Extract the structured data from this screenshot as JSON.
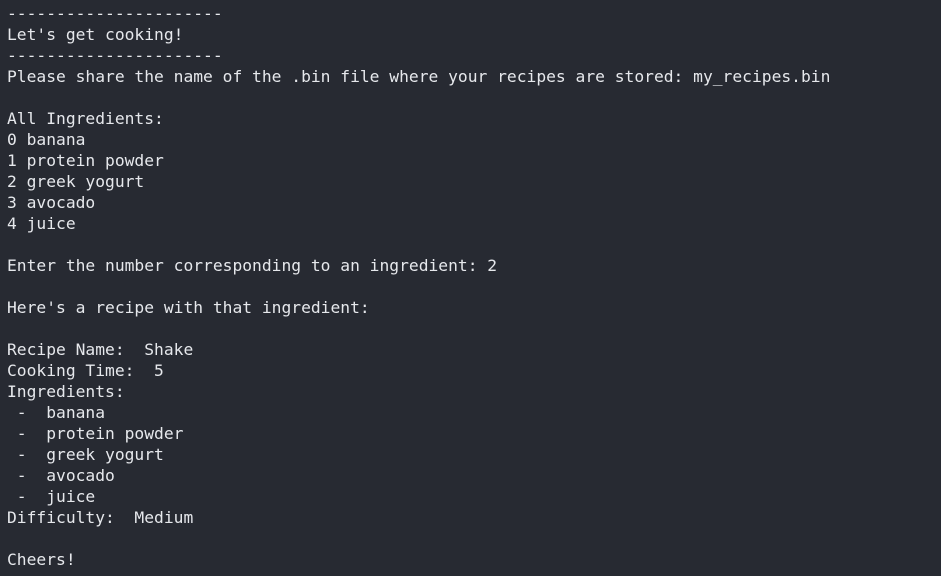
{
  "terminal": {
    "lines": [
      "----------------------",
      "Let's get cooking!",
      "----------------------",
      "Please share the name of the .bin file where your recipes are stored: my_recipes.bin",
      "",
      "All Ingredients:",
      "0 banana",
      "1 protein powder",
      "2 greek yogurt",
      "3 avocado",
      "4 juice",
      "",
      "Enter the number corresponding to an ingredient: 2",
      "",
      "Here's a recipe with that ingredient:",
      "",
      "Recipe Name:  Shake",
      "Cooking Time:  5",
      "Ingredients:",
      " -  banana",
      " -  protein powder",
      " -  greek yogurt",
      " -  avocado",
      " -  juice",
      "Difficulty:  Medium",
      "",
      "Cheers!"
    ]
  },
  "colors": {
    "background": "#272a32",
    "text": "#e6e8ec"
  }
}
